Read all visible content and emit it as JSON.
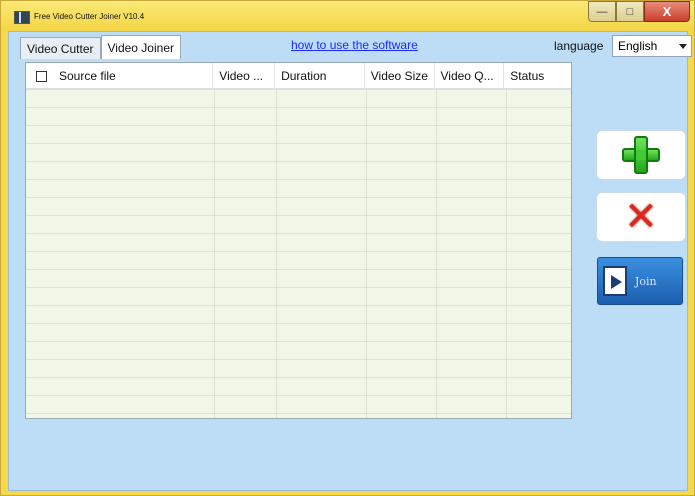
{
  "window": {
    "title": "Free Video Cutter Joiner V10.4",
    "minimize_symbol": "—",
    "maximize_symbol": "□",
    "close_symbol": "X"
  },
  "tabs": [
    {
      "label": "Video Cutter",
      "active": false
    },
    {
      "label": "Video Joiner",
      "active": true
    }
  ],
  "help_link": "how to use the software",
  "language": {
    "label": "language",
    "selected": "English"
  },
  "table": {
    "columns": [
      "Source file",
      "Video ...",
      "Duration",
      "Video Size",
      "Video Q...",
      "Status"
    ],
    "rows": []
  },
  "actions": {
    "add_icon": "plus-icon",
    "remove_icon": "x-icon",
    "remove_symbol": "✕",
    "join_label": "Join"
  },
  "colors": {
    "title_bar": "#f5d94a",
    "client_bg": "#bdddf6",
    "table_bg": "#f0f7e6",
    "link": "#1a2bff",
    "join_button": "#2a74c8"
  }
}
